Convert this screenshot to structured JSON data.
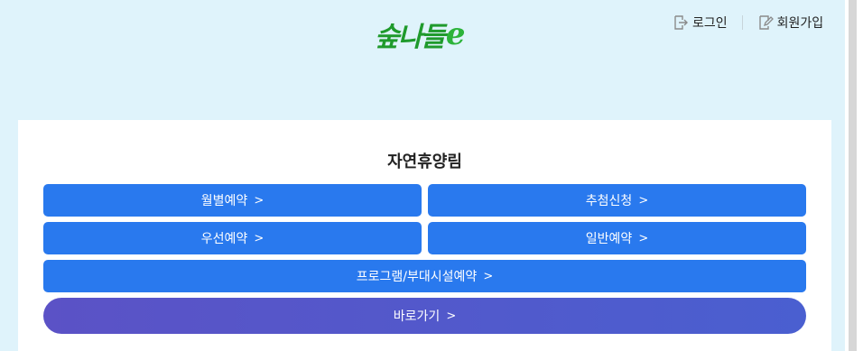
{
  "header": {
    "logo_text": "숲나들",
    "logo_suffix": "e",
    "login_label": "로그인",
    "signup_label": "회원가입"
  },
  "main": {
    "title": "자연휴양림",
    "buttons": {
      "monthly": "월별예약",
      "lottery": "추첨신청",
      "priority": "우선예약",
      "general": "일반예약",
      "program": "프로그램/부대시설예약",
      "go": "바로가기"
    },
    "chevron": ">"
  },
  "colors": {
    "background": "#dff3fb",
    "button_blue": "#2979ee",
    "go_button": "#5554c8",
    "logo_green": "#1f9a2c"
  }
}
